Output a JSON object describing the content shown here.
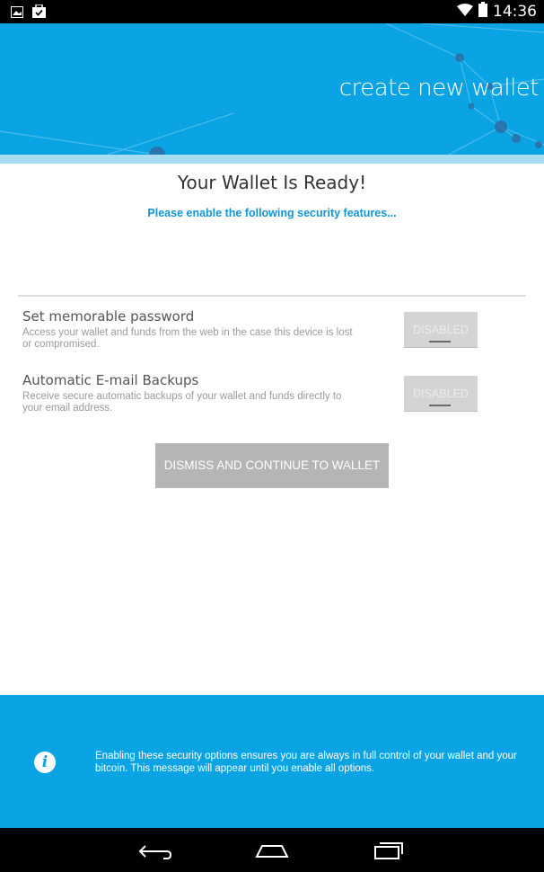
{
  "status_bar": {
    "time": "14:36",
    "left_icons": [
      "image-icon",
      "shopping-bag-check-icon"
    ],
    "right_icons": [
      "wifi-icon",
      "battery-icon"
    ]
  },
  "header": {
    "title": "create new wallet",
    "bg_color": "#0aa3e3"
  },
  "main": {
    "title": "Your Wallet Is Ready!",
    "subtitle": "Please enable the following security features...",
    "options": [
      {
        "title": "Set memorable password",
        "description": "Access your wallet and funds from the web in the case this device is lost or compromised.",
        "toggle_label": "DISABLED"
      },
      {
        "title": "Automatic E-mail Backups",
        "description": "Receive secure automatic backups of your wallet and funds directly to your email address.",
        "toggle_label": "DISABLED"
      }
    ],
    "dismiss_label": "DISMISS AND CONTINUE TO WALLET"
  },
  "footer": {
    "info_text": "Enabling these security options ensures you are always in full control of your wallet and your bitcoin. This message will appear until you enable all options."
  },
  "nav_bar": {
    "buttons": [
      "back-icon",
      "home-icon",
      "recents-icon"
    ]
  }
}
